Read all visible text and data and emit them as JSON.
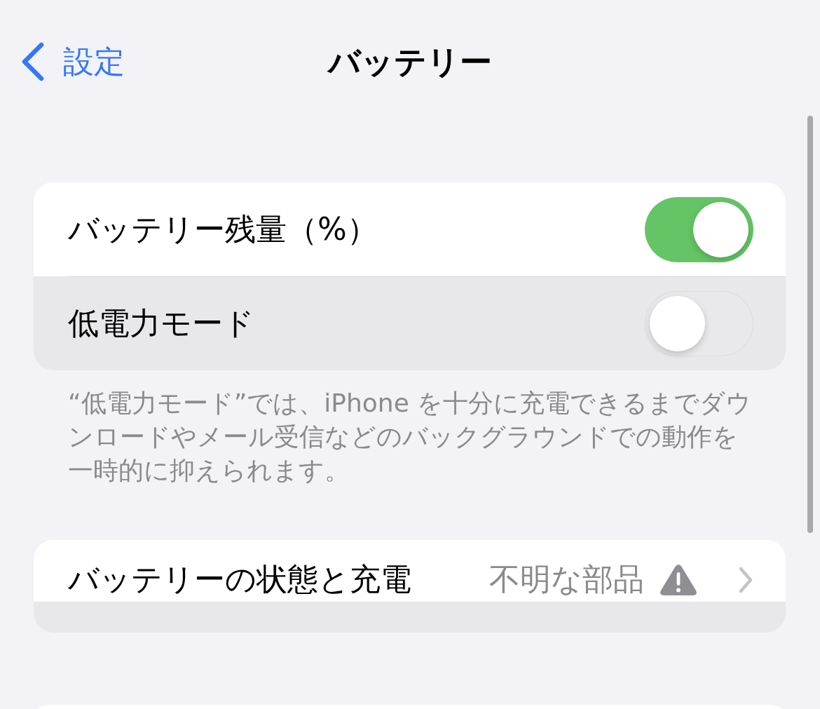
{
  "nav": {
    "back_label": "設定",
    "title": "バッテリー"
  },
  "groups": [
    {
      "rows": [
        {
          "kind": "toggle",
          "label": "バッテリー残量（%）",
          "on": true,
          "highlighted": false
        },
        {
          "kind": "toggle",
          "label": "低電力モード",
          "on": false,
          "highlighted": true
        }
      ],
      "footer": "“低電力モード”では、iPhone を十分に充電できるまでダウンロードやメール受信などのバックグラウンドでの動作を一時的に抑えられます。"
    },
    {
      "rows": [
        {
          "kind": "link",
          "label": "バッテリーの状態と充電",
          "value": "不明な部品",
          "warning": true,
          "highlighted": false
        }
      ]
    }
  ]
}
